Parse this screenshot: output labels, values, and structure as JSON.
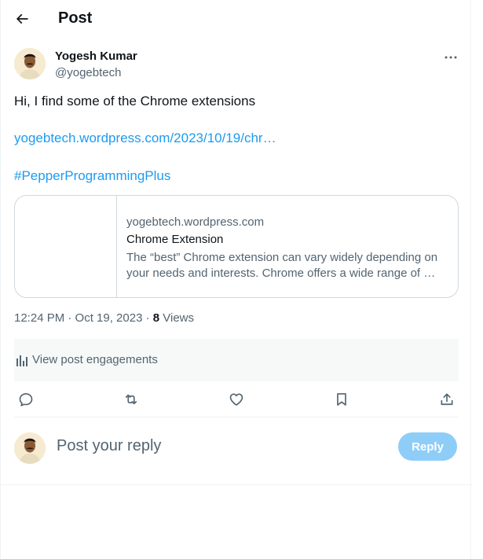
{
  "header": {
    "title": "Post",
    "back_icon": "arrow-left-icon"
  },
  "author": {
    "name": "Yogesh Kumar",
    "handle": "@yogebtech"
  },
  "post": {
    "text": "Hi, I find some of the Chrome extensions",
    "link": "yogebtech.wordpress.com/2023/10/19/chr…",
    "hashtag": "#PepperProgrammingPlus"
  },
  "card": {
    "domain": "yogebtech.wordpress.com",
    "title": "Chrome Extension",
    "description": "The “best” Chrome extension can vary widely depending on your needs and interests. Chrome offers a wide range of …"
  },
  "meta": {
    "timestamp": "12:24 PM · Oct 19, 2023 · ",
    "views_count": "8",
    "views_label": " Views"
  },
  "engagements": {
    "label": "View post engagements"
  },
  "reply": {
    "placeholder": "Post your reply",
    "button_label": "Reply"
  },
  "colors": {
    "accent": "#1d9bf0",
    "reply_button_disabled": "#8ecdf8",
    "muted_text": "#536471"
  }
}
